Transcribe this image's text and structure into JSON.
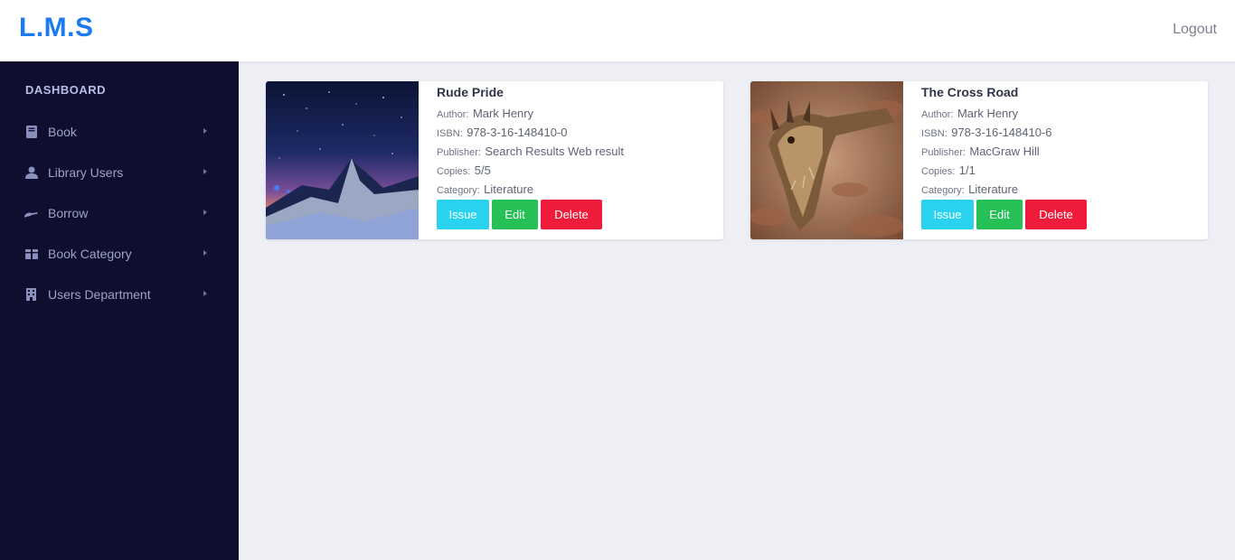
{
  "header": {
    "brand": "L.M.S",
    "logout": "Logout"
  },
  "sidebar": {
    "heading": "DASHBOARD",
    "items": [
      {
        "label": "Book",
        "icon": "book-icon"
      },
      {
        "label": "Library Users",
        "icon": "user-icon"
      },
      {
        "label": "Borrow",
        "icon": "hand-icon"
      },
      {
        "label": "Book Category",
        "icon": "box-icon"
      },
      {
        "label": "Users Department",
        "icon": "building-icon"
      }
    ]
  },
  "labels": {
    "author": "Author",
    "isbn": "ISBN",
    "publisher": "Publisher",
    "copies": "Copies",
    "category": "Category",
    "separator": ":"
  },
  "books": [
    {
      "title": "Rude Pride",
      "author": "Mark Henry",
      "isbn": "978-3-16-148410-0",
      "publisher": "Search Results Web result",
      "copies": "5/5",
      "category": "Literature",
      "image": "starry-mountain-cover",
      "actions": {
        "issue": "Issue",
        "edit": "Edit",
        "delete": "Delete"
      }
    },
    {
      "title": "The Cross Road",
      "author": "Mark Henry",
      "isbn": "978-3-16-148410-6",
      "publisher": "MacGraw Hill",
      "copies": "1/1",
      "category": "Literature",
      "image": "horned-lizard-cover",
      "actions": {
        "issue": "Issue",
        "edit": "Edit",
        "delete": "Delete"
      }
    }
  ],
  "colors": {
    "brand": "#1a7cf0",
    "sidebar": "#0f0e2e",
    "issue": "#29d3f0",
    "edit": "#25c157",
    "delete": "#ef1b3b"
  }
}
